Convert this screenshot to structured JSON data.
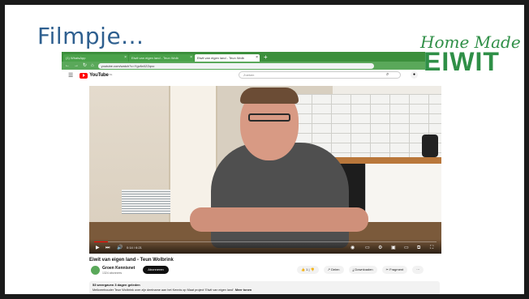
{
  "slide": {
    "title": "Filmpje...",
    "logo_top": "Home Made",
    "logo_bottom": "EIWIT"
  },
  "browser": {
    "tabs": [
      {
        "label": "(1) WhatsApp",
        "active": false
      },
      {
        "label": "Eiwit van eigen land - Teun Wolb",
        "active": false
      },
      {
        "label": "Eiwit van eigen land - Teun Wolb",
        "active": true
      }
    ],
    "new_tab": "+",
    "url": "youtube.com/watch?v=Ygv6x0ZZqxo"
  },
  "youtube": {
    "brand": "YouTube",
    "country": "NL",
    "search_placeholder": "Zoeken",
    "video": {
      "time": "0:14 / 6:21",
      "progress": 0.04
    },
    "title": "Eiwit van eigen land - Teun Wolbrink",
    "channel": {
      "name": "Groen Kennisnet",
      "subscribers": "1324 abonnees",
      "subscribe_label": "Abonneren"
    },
    "actions": {
      "likes": "1",
      "share": "Delen",
      "download": "Downloaden",
      "clip": "Fragment",
      "more": "···"
    },
    "description": {
      "meta": "53 weergaven  3 dagen geleden",
      "text": "Melkveehouder Teun Wolbrink over zijn deelname aan het Kennis op Maat project 'Eiwit van eigen land'.",
      "more": "Meer tonen"
    }
  },
  "colors": {
    "title": "#2e5f8f",
    "logo": "#2f8f47",
    "tabbar": "#3c8f3c",
    "yt_red": "#ff0000"
  }
}
